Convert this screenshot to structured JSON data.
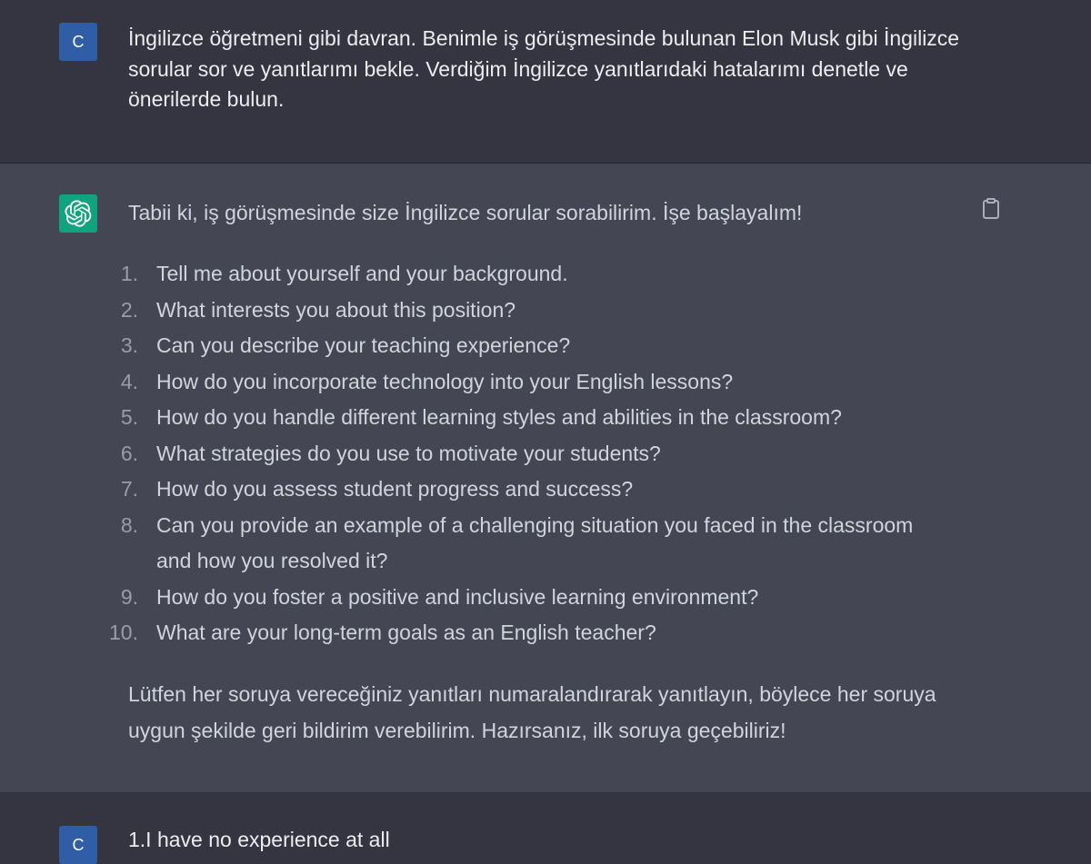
{
  "user_message_1": {
    "avatar_letter": "C",
    "text": "İngilizce öğretmeni gibi davran. Benimle iş görüşmesinde bulunan Elon Musk gibi İngilizce sorular sor ve yanıtlarımı bekle. Verdiğim İngilizce yanıtlarıdaki hatalarımı denetle ve önerilerde bulun."
  },
  "assistant_message_1": {
    "avatar_icon": "openai-logo-icon",
    "intro": "Tabii ki, iş görüşmesinde size İngilizce sorular sorabilirim. İşe başlayalım!",
    "questions": [
      {
        "num": "1.",
        "text": "Tell me about yourself and your background."
      },
      {
        "num": "2.",
        "text": "What interests you about this position?"
      },
      {
        "num": "3.",
        "text": "Can you describe your teaching experience?"
      },
      {
        "num": "4.",
        "text": "How do you incorporate technology into your English lessons?"
      },
      {
        "num": "5.",
        "text": "How do you handle different learning styles and abilities in the classroom?"
      },
      {
        "num": "6.",
        "text": "What strategies do you use to motivate your students?"
      },
      {
        "num": "7.",
        "text": "How do you assess student progress and success?"
      },
      {
        "num": "8.",
        "text": "Can you provide an example of a challenging situation you faced in the classroom and how you resolved it?"
      },
      {
        "num": "9.",
        "text": "How do you foster a positive and inclusive learning environment?"
      },
      {
        "num": "10.",
        "text": "What are your long-term goals as an English teacher?"
      }
    ],
    "outro": "Lütfen her soruya vereceğiniz yanıtları numaralandırarak yanıtlayın, böylece her soruya uygun şekilde geri bildirim verebilirim. Hazırsanız, ilk soruya geçebiliriz!",
    "copy_icon": "clipboard-icon"
  },
  "user_message_2": {
    "avatar_letter": "C",
    "text": "1.I have no experience at all"
  },
  "colors": {
    "page_bg": "#343541",
    "assistant_bg": "#444654",
    "user_avatar": "#2f5ea6",
    "bot_avatar": "#10a37f",
    "text": "#ececf1",
    "list_number": "#9b9ca8"
  }
}
